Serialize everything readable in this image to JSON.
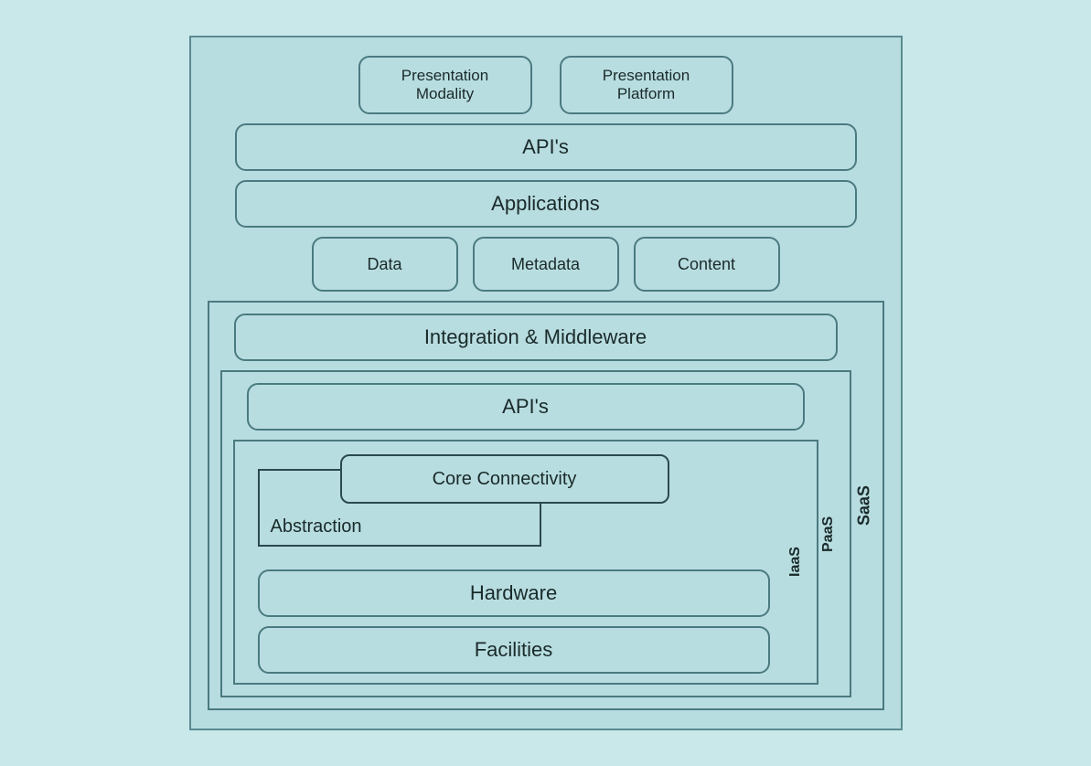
{
  "layers": {
    "presentation_modality": "Presentation\nModality",
    "presentation_platform": "Presentation\nPlatform",
    "apis_top": "API's",
    "applications": "Applications",
    "data": "Data",
    "metadata": "Metadata",
    "content": "Content",
    "integration_middleware": "Integration & Middleware",
    "apis_paas": "API's",
    "core_connectivity": "Core Connectivity",
    "abstraction": "Abstraction",
    "hardware": "Hardware",
    "facilities": "Facilities"
  },
  "labels": {
    "saas": "SaaS",
    "paas": "PaaS",
    "iaas": "IaaS"
  },
  "colors": {
    "background": "#b8dde0",
    "border": "#4a7a80",
    "text": "#1a2a2a"
  }
}
